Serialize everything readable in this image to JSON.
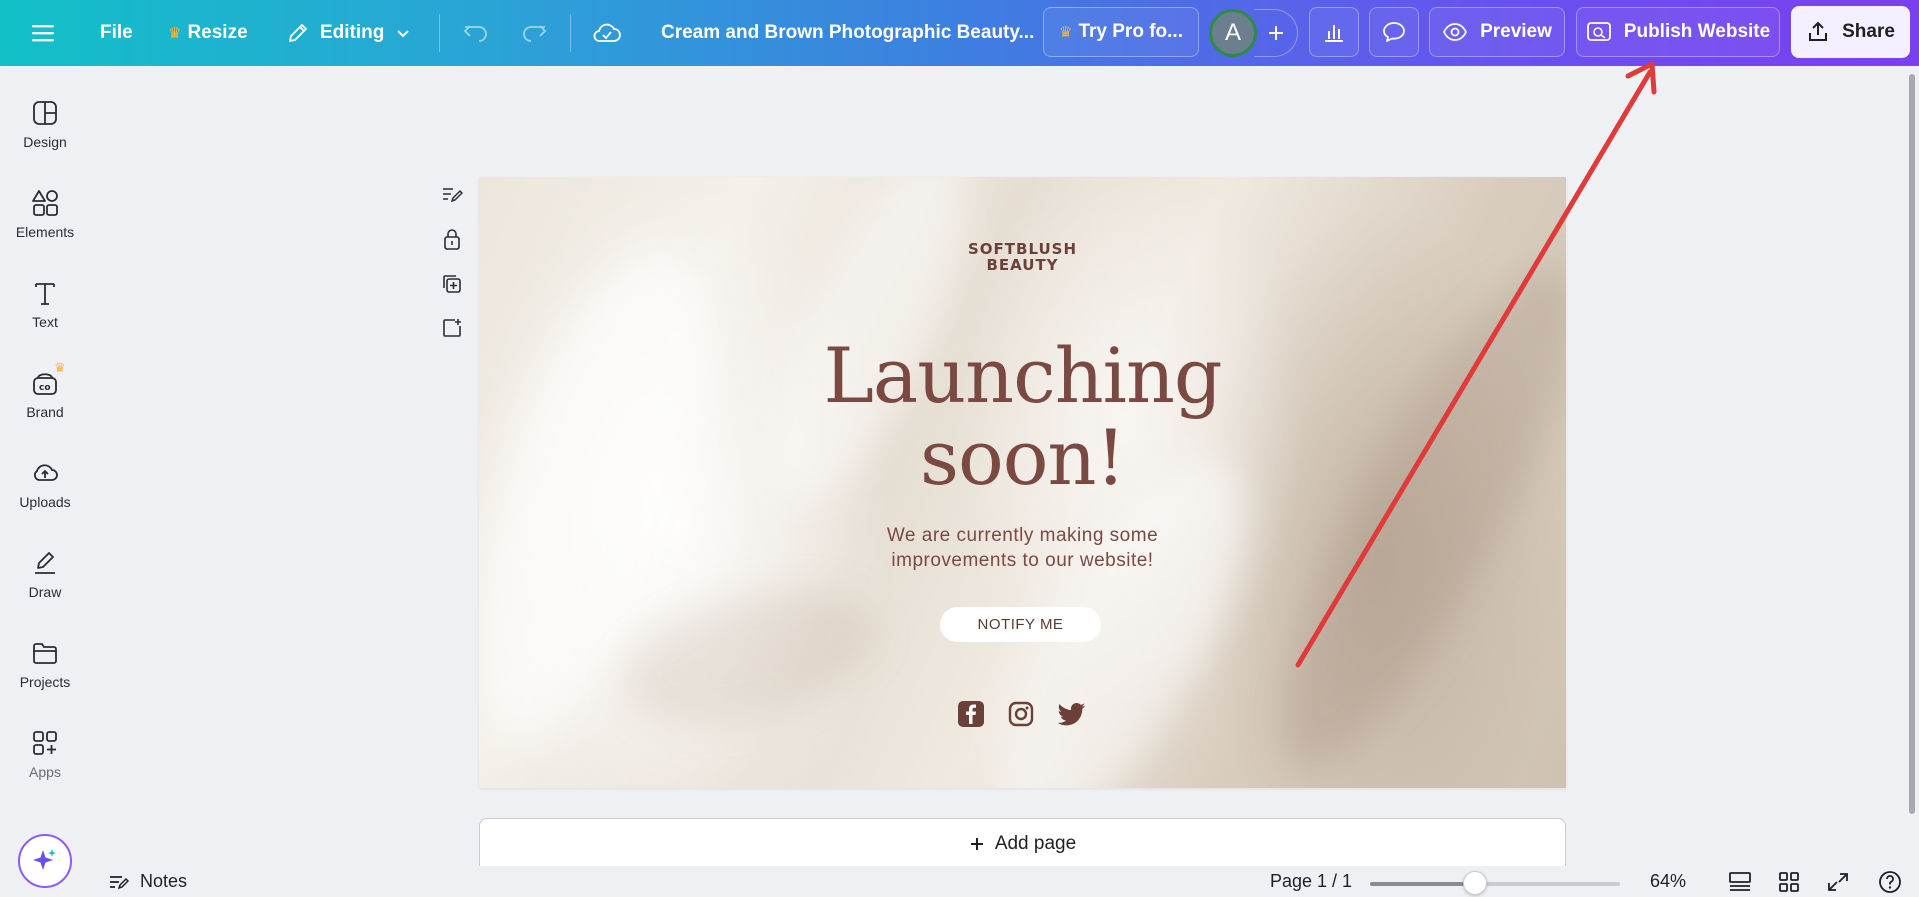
{
  "topbar": {
    "file_label": "File",
    "resize_label": "Resize",
    "editing_label": "Editing",
    "doc_title": "Cream and Brown Photographic Beauty...",
    "try_pro_label": "Try Pro fo...",
    "avatar_initial": "A",
    "preview_label": "Preview",
    "publish_label": "Publish Website",
    "share_label": "Share"
  },
  "sidebar": {
    "items": [
      {
        "label": "Design",
        "icon": "layout-icon"
      },
      {
        "label": "Elements",
        "icon": "shapes-icon"
      },
      {
        "label": "Text",
        "icon": "text-icon"
      },
      {
        "label": "Brand",
        "icon": "brand-icon"
      },
      {
        "label": "Uploads",
        "icon": "cloud-upload-icon"
      },
      {
        "label": "Draw",
        "icon": "pen-icon"
      },
      {
        "label": "Projects",
        "icon": "folder-icon"
      },
      {
        "label": "Apps",
        "icon": "apps-icon"
      }
    ]
  },
  "design": {
    "brand_line1": "SOFTBLUSH",
    "brand_line2": "BEAUTY",
    "headline_line1": "Launching",
    "headline_line2": "soon!",
    "sub_line1": "We are currently making some",
    "sub_line2": "improvements to our website!",
    "notify_label": "NOTIFY ME",
    "text_color": "#7a4a42"
  },
  "add_page_label": "Add page",
  "bottombar": {
    "notes_label": "Notes",
    "page_indicator": "Page 1 / 1",
    "zoom_label": "64%",
    "zoom_fraction": 0.42
  },
  "colors": {
    "accent": "#7b3ff0",
    "teal": "#12c0c8",
    "arrow": "#e03a3a"
  }
}
